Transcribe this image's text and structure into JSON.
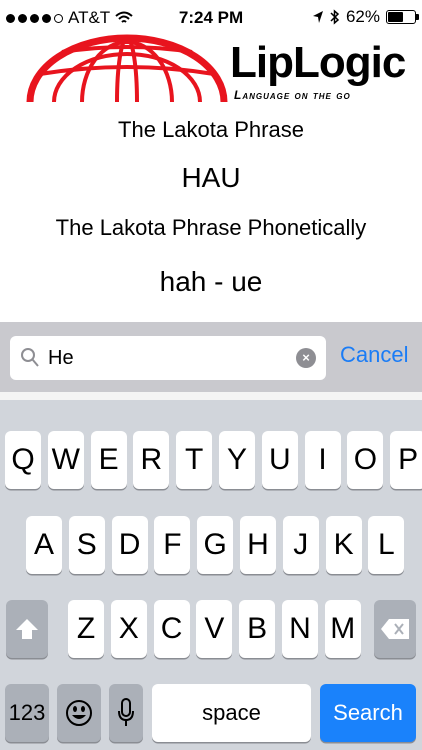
{
  "status": {
    "carrier": "AT&T",
    "time": "7:24 PM",
    "battery": "62%",
    "battery_level": 0.62,
    "icons": [
      "signal-dots",
      "wifi-icon",
      "location-icon",
      "bluetooth-icon",
      "battery-icon"
    ]
  },
  "brand": {
    "name": "LipLogic",
    "tagline": "Language on the go",
    "colors": {
      "globe": "#e8141e"
    }
  },
  "content": {
    "phrase_label": "The Lakota Phrase",
    "phrase": "HAU",
    "phonetic_label": "The Lakota Phrase Phonetically",
    "phonetic": "hah - ue"
  },
  "search": {
    "value": "He",
    "cancel_label": "Cancel",
    "clear_icon": "×"
  },
  "keyboard": {
    "row1": [
      "Q",
      "W",
      "E",
      "R",
      "T",
      "Y",
      "U",
      "I",
      "O",
      "P"
    ],
    "row2": [
      "A",
      "S",
      "D",
      "F",
      "G",
      "H",
      "J",
      "K",
      "L"
    ],
    "row3": [
      "Z",
      "X",
      "C",
      "V",
      "B",
      "N",
      "M"
    ],
    "numbers_label": "123",
    "space_label": "space",
    "search_label": "Search",
    "icons": [
      "shift-icon",
      "backspace-icon",
      "emoji-icon",
      "microphone-icon"
    ],
    "colors": {
      "background": "#d1d5db",
      "accent": "#1a82fb"
    }
  }
}
